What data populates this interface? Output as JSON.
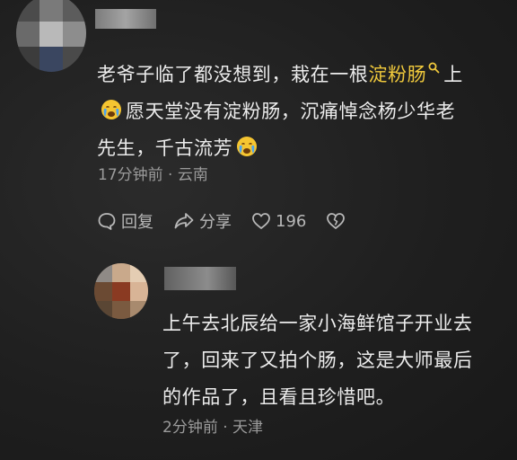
{
  "comments": [
    {
      "text_part1": "老爷子临了都没想到，栽在一根",
      "link_text": "淀粉肠",
      "text_part2": "上",
      "text_part3": "愿天堂没有淀粉肠，沉痛悼念杨少华老",
      "text_part4": "先生，千古流芳",
      "time": "17分钟前",
      "separator": "·",
      "location": "云南",
      "reply_label": "回复",
      "share_label": "分享",
      "like_count": "196",
      "emoji_name": "crying-face-emoji",
      "link_color": "#f0c93c"
    },
    {
      "line1": "上午去北辰给一家小海鲜馆子开业去",
      "line2": "了，回来了又拍个肠，这是大师最后",
      "line3": "的作品了，且看且珍惜吧。",
      "time": "2分钟前",
      "separator": "·",
      "location": "天津"
    }
  ],
  "icons": {
    "reply": "comment-bubble-icon",
    "share": "share-arrow-icon",
    "like": "heart-icon",
    "dislike": "broken-heart-icon",
    "search": "search-icon"
  }
}
